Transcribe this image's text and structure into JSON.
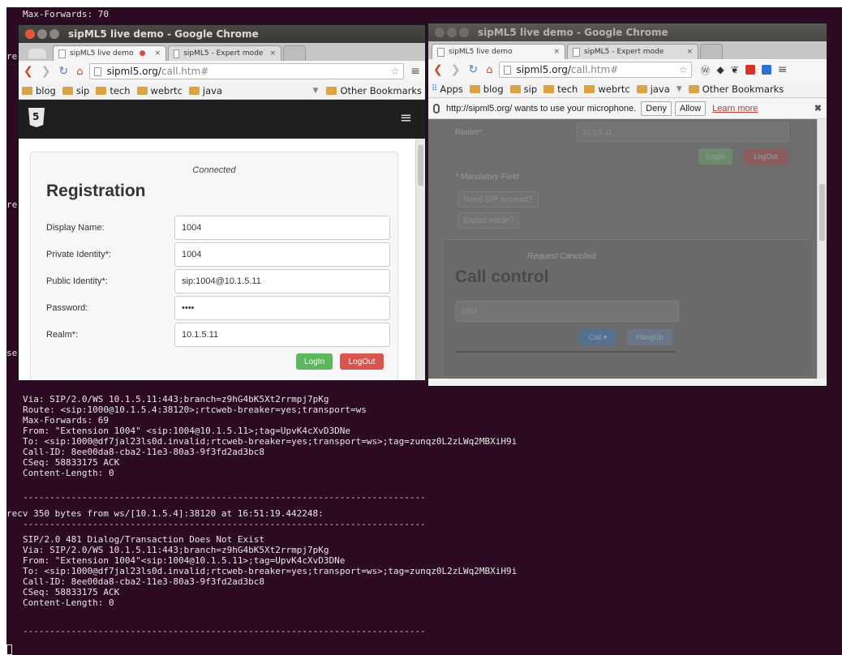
{
  "terminal": {
    "top_line": "Max-Forwards: 70",
    "side_fragments": [
      "re",
      "re",
      "re",
      "se"
    ],
    "block1": [
      "Via: SIP/2.0/WS 10.1.5.11:443;branch=z9hG4bK5Xt2rrmpj7pKg",
      "Route: <sip:1000@10.1.5.4:38120>;rtcweb-breaker=yes;transport=ws",
      "Max-Forwards: 69",
      "From: \"Extension 1004\" <sip:1004@10.1.5.11>;tag=UpvK4cXvD3DNe",
      "To: <sip:1000@df7jal23ls0d.invalid;rtcweb-breaker=yes;transport=ws>;tag=zunqz0L2zLWq2MBXiH9i",
      "Call-ID: 8ee00da8-cba2-11e3-80a3-9f3fd2ad3bc8",
      "CSeq: 58833175 ACK",
      "Content-Length: 0"
    ],
    "separator": "---------------------------------------------------------------------------",
    "recv_line": "recv 350 bytes from ws/[10.1.5.4]:38120 at 16:51:19.442248:",
    "block2": [
      "SIP/2.0 481 Dialog/Transaction Does Not Exist",
      "Via: SIP/2.0/WS 10.1.5.11:443;branch=z9hG4bK5Xt2rrmpj7pKg",
      "From: \"Extension 1004\"<sip:1004@10.1.5.11>;tag=UpvK4cXvD3DNe",
      "To: <sip:1000@df7jal23ls0d.invalid;rtcweb-breaker=yes;transport=ws>;tag=zunqz0L2zLWq2MBXiH9i",
      "Call-ID: 8ee00da8-cba2-11e3-80a3-9f3fd2ad3bc8",
      "CSeq: 58833175 ACK",
      "Content-Length: 0"
    ]
  },
  "left_window": {
    "title": "sipML5 live demo - Google Chrome",
    "tabs": [
      "sipML5 live demo",
      "sipML5 - Expert mode"
    ],
    "url_host": "sipml5.org/",
    "url_path": "call.htm#",
    "bookmarks": [
      "blog",
      "sip",
      "tech",
      "webrtc",
      "java"
    ],
    "other_bookmarks": "Other Bookmarks",
    "status": "Connected",
    "heading": "Registration",
    "fields": [
      {
        "label": "Display Name:",
        "value": "1004"
      },
      {
        "label": "Private Identity*:",
        "value": "1004"
      },
      {
        "label": "Public Identity*:",
        "value": "sip:1004@10.1.5.11"
      },
      {
        "label": "Password:",
        "value": "••••"
      },
      {
        "label": "Realm*:",
        "value": "10.1.5.11"
      }
    ],
    "login_label": "LogIn",
    "logout_label": "LogOut"
  },
  "right_window": {
    "title": "sipML5 live demo - Google Chrome",
    "tabs": [
      "sipML5 live demo",
      "sipML5 - Expert mode"
    ],
    "url_host": "sipml5.org/",
    "url_path": "call.htm#",
    "apps_label": "Apps",
    "bookmarks": [
      "blog",
      "sip",
      "tech",
      "webrtc",
      "java"
    ],
    "other_bookmarks": "Other Bookmarks",
    "infobar_text": "http://sipml5.org/ wants to use your microphone.",
    "deny_label": "Deny",
    "allow_label": "Allow",
    "learn_more_label": "Learn more",
    "realm_label": "Realm*:",
    "realm_value": "10.1.5.11",
    "login_label": "LogIn",
    "logout_label": "LogOut",
    "mandatory_note": "* Mandatory Field",
    "need_account_label": "Need SIP account?",
    "expert_mode_label": "Expert mode?",
    "call_status": "Request Cancelled",
    "call_heading": "Call control",
    "call_number": "1004",
    "call_button_label": "Call ▾",
    "hangup_label": "HangUp"
  }
}
